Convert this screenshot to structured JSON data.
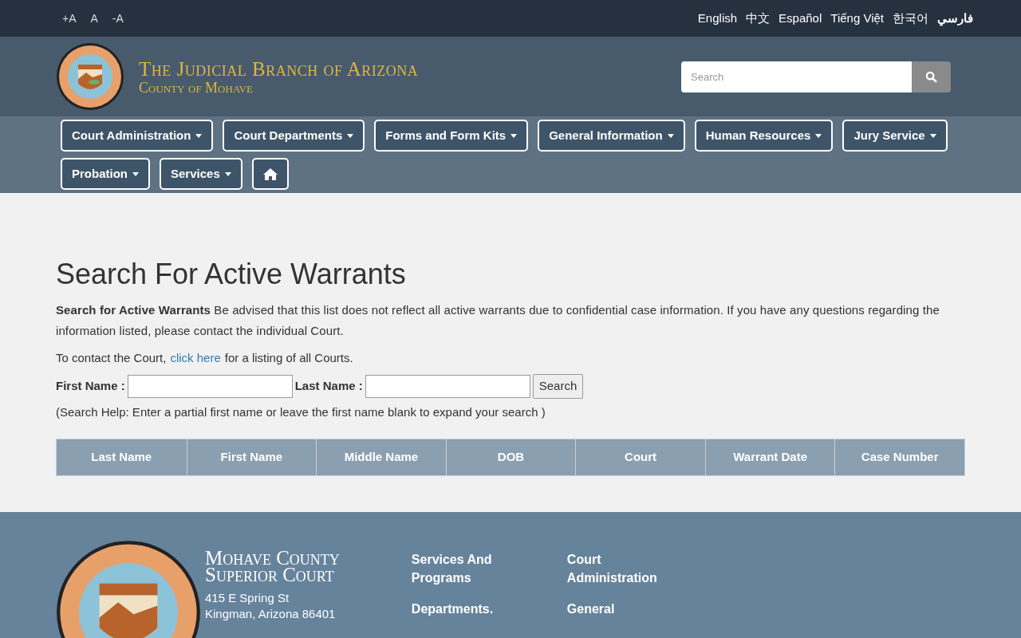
{
  "font_size_controls": [
    "+A",
    "A",
    "-A"
  ],
  "languages": [
    {
      "label": "English",
      "bold": false
    },
    {
      "label": "中文",
      "bold": false
    },
    {
      "label": "Español",
      "bold": false
    },
    {
      "label": "Tiếng Việt",
      "bold": false
    },
    {
      "label": "한국어",
      "bold": false
    },
    {
      "label": "فارسي",
      "bold": true
    }
  ],
  "header": {
    "title": "The Judicial Branch of Arizona",
    "subtitle": "County of Mohave",
    "search": {
      "placeholder": "Search"
    }
  },
  "nav": [
    {
      "label": "Court Administration",
      "kind": "dropdown"
    },
    {
      "label": "Court Departments",
      "kind": "dropdown"
    },
    {
      "label": "Forms and Form Kits",
      "kind": "dropdown"
    },
    {
      "label": "General Information",
      "kind": "dropdown"
    },
    {
      "label": "Human Resources",
      "kind": "dropdown"
    },
    {
      "label": "Jury Service",
      "kind": "dropdown"
    },
    {
      "label": "Probation",
      "kind": "dropdown"
    },
    {
      "label": "Services",
      "kind": "dropdown"
    },
    {
      "kind": "home"
    }
  ],
  "page": {
    "heading": "Search For Active Warrants",
    "notice": "**Search for Active Warrants** Be advised that this list does not reflect all active warrants due to confidential case information. If you have any questions regarding the information listed, please contact the individual Court.",
    "contact_before": "To contact the Court,",
    "contact_link": "click here",
    "contact_after": "for a listing of all Courts.",
    "first_name_label": "First Name :",
    "last_name_label": "Last Name :",
    "search_button": "Search",
    "help": "(Search Help: Enter a partial first name or leave the first name blank to expand your search )",
    "table": {
      "columns": [
        "Last Name",
        "First Name",
        "Middle Name",
        "DOB",
        "Court",
        "Warrant Date",
        "Case Number"
      ]
    }
  },
  "footer": {
    "title_line_1": "Mohave County",
    "title_line_2": "Superior Court",
    "address_line_1": "415 E Spring St",
    "address_line_2": "Kingman, Arizona 86401",
    "links": [
      "Services And Programs",
      "Court Administration",
      "Departments.",
      "General"
    ]
  }
}
